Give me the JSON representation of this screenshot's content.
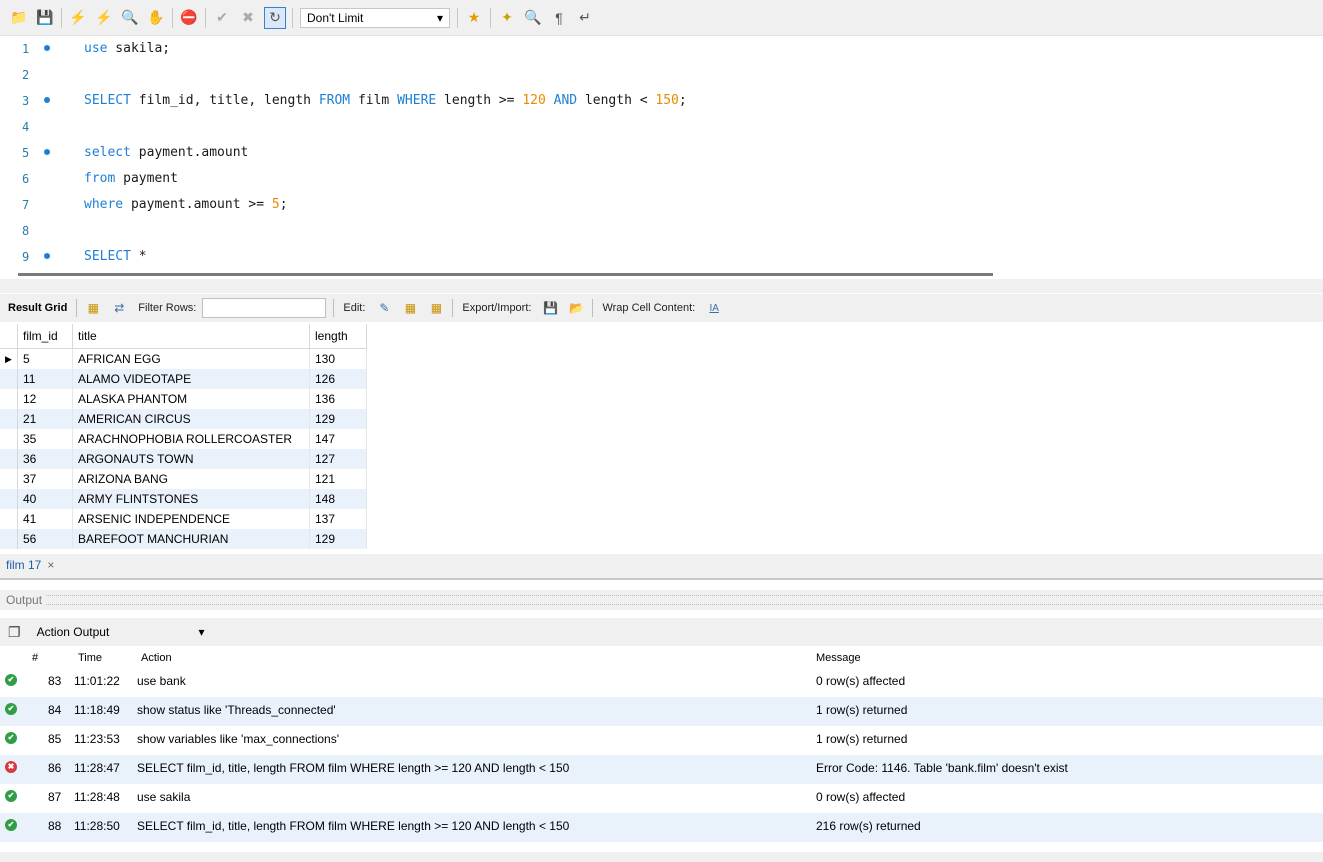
{
  "toolbar": {
    "limit_label": "Don't Limit",
    "icons": [
      "open-folder-icon",
      "save-icon",
      "execute-lightning-icon",
      "execute-current-icon",
      "explain-magnifier-icon",
      "stop-icon",
      "toggle-error-icon",
      "commit-icon",
      "rollback-icon",
      "autocommit-icon",
      "beautify-star-icon",
      "broom-icon",
      "find-icon",
      "invisible-chars-icon",
      "wrap-icon"
    ]
  },
  "editor": {
    "lines": [
      {
        "n": "1",
        "dot": true,
        "code": "use sakila;"
      },
      {
        "n": "2",
        "dot": false,
        "code": ""
      },
      {
        "n": "3",
        "dot": true,
        "code": "SELECT film_id, title, length FROM film WHERE length >= 120 AND length < 150;"
      },
      {
        "n": "4",
        "dot": false,
        "code": ""
      },
      {
        "n": "5",
        "dot": true,
        "code": "select payment.amount"
      },
      {
        "n": "6",
        "dot": false,
        "code": "from payment"
      },
      {
        "n": "7",
        "dot": false,
        "code": "where payment.amount >= 5;"
      },
      {
        "n": "8",
        "dot": false,
        "code": ""
      },
      {
        "n": "9",
        "dot": true,
        "code": "SELECT *"
      }
    ]
  },
  "result_toolbar": {
    "result_grid": "Result Grid",
    "filter_rows": "Filter Rows:",
    "edit": "Edit:",
    "export_import": "Export/Import:",
    "wrap_cell": "Wrap Cell Content:"
  },
  "grid": {
    "columns": [
      "film_id",
      "title",
      "length"
    ],
    "rows": [
      [
        "5",
        "AFRICAN EGG",
        "130"
      ],
      [
        "11",
        "ALAMO VIDEOTAPE",
        "126"
      ],
      [
        "12",
        "ALASKA PHANTOM",
        "136"
      ],
      [
        "21",
        "AMERICAN CIRCUS",
        "129"
      ],
      [
        "35",
        "ARACHNOPHOBIA ROLLERCOASTER",
        "147"
      ],
      [
        "36",
        "ARGONAUTS TOWN",
        "127"
      ],
      [
        "37",
        "ARIZONA BANG",
        "121"
      ],
      [
        "40",
        "ARMY FLINTSTONES",
        "148"
      ],
      [
        "41",
        "ARSENIC INDEPENDENCE",
        "137"
      ],
      [
        "56",
        "BAREFOOT MANCHURIAN",
        "129"
      ]
    ]
  },
  "tab": {
    "label": "film 17",
    "close": "×"
  },
  "output": {
    "title": "Output",
    "action_output": "Action Output",
    "headers": {
      "num": "#",
      "time": "Time",
      "action": "Action",
      "message": "Message"
    },
    "rows": [
      {
        "status": "ok",
        "num": "83",
        "time": "11:01:22",
        "action": "use bank",
        "message": "0 row(s) affected"
      },
      {
        "status": "ok",
        "num": "84",
        "time": "11:18:49",
        "action": "show status like 'Threads_connected'",
        "message": "1 row(s) returned"
      },
      {
        "status": "ok",
        "num": "85",
        "time": "11:23:53",
        "action": "show variables like 'max_connections'",
        "message": "1 row(s) returned"
      },
      {
        "status": "err",
        "num": "86",
        "time": "11:28:47",
        "action": "SELECT film_id, title, length FROM film WHERE length >= 120 AND length < 150",
        "message": "Error Code: 1146. Table 'bank.film' doesn't exist"
      },
      {
        "status": "ok",
        "num": "87",
        "time": "11:28:48",
        "action": "use sakila",
        "message": "0 row(s) affected"
      },
      {
        "status": "ok",
        "num": "88",
        "time": "11:28:50",
        "action": "SELECT film_id, title, length FROM film WHERE length >= 120 AND length < 150",
        "message": "216 row(s) returned"
      }
    ]
  }
}
